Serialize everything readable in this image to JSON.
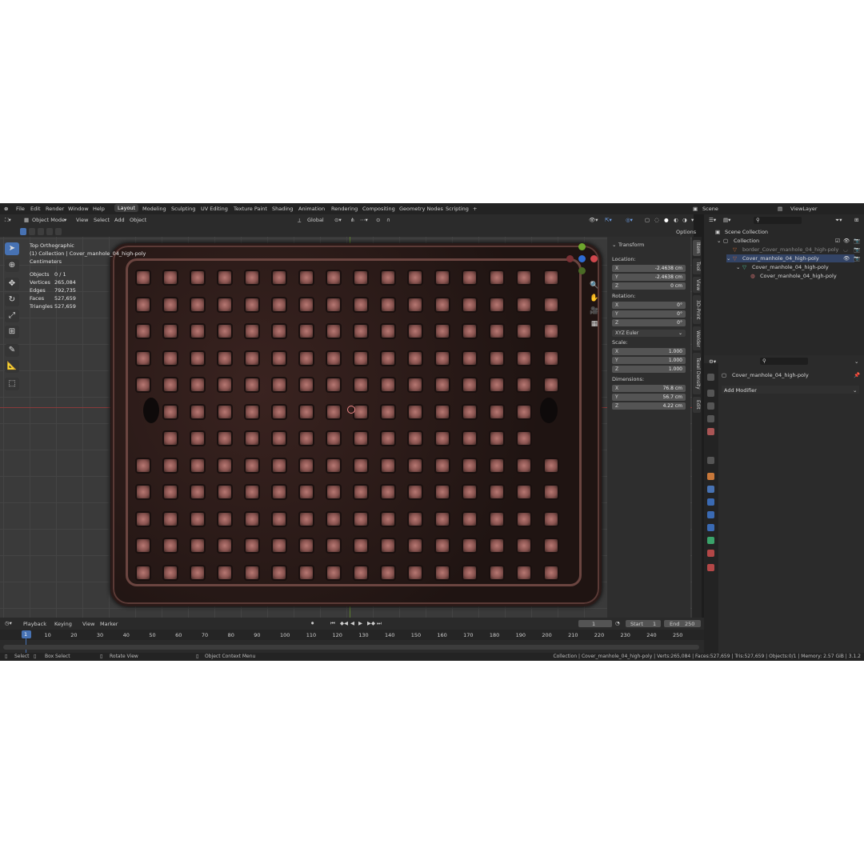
{
  "menu": {
    "items": [
      "File",
      "Edit",
      "Render",
      "Window",
      "Help"
    ],
    "workspaces": [
      "Layout",
      "Modeling",
      "Sculpting",
      "UV Editing",
      "Texture Paint",
      "Shading",
      "Animation",
      "Rendering",
      "Compositing",
      "Geometry Nodes",
      "Scripting",
      "+"
    ],
    "active_workspace": "Layout",
    "scene_label": "Scene",
    "view_layer_label": "ViewLayer"
  },
  "viewport_header": {
    "mode": "Object Mode",
    "menus": [
      "View",
      "Select",
      "Add",
      "Object"
    ],
    "orientation": "Global",
    "options": "Options"
  },
  "overlay": {
    "view_name": "Top Orthographic",
    "collection_line": "(1) Collection | Cover_manhole_04_high-poly",
    "units": "Centimeters",
    "stats": [
      {
        "label": "Objects",
        "value": "0 / 1"
      },
      {
        "label": "Vertices",
        "value": "265,084"
      },
      {
        "label": "Edges",
        "value": "792,735"
      },
      {
        "label": "Faces",
        "value": "527,659"
      },
      {
        "label": "Triangles",
        "value": "527,659"
      }
    ]
  },
  "npanel": {
    "section": "Transform",
    "location_label": "Location:",
    "location": [
      {
        "axis": "X",
        "value": "-2.4638 cm"
      },
      {
        "axis": "Y",
        "value": "-2.4638 cm"
      },
      {
        "axis": "Z",
        "value": "0 cm"
      }
    ],
    "rotation_label": "Rotation:",
    "rotation": [
      {
        "axis": "X",
        "value": "0°"
      },
      {
        "axis": "Y",
        "value": "0°"
      },
      {
        "axis": "Z",
        "value": "0°"
      }
    ],
    "rotation_mode": "XYZ Euler",
    "scale_label": "Scale:",
    "scale": [
      {
        "axis": "X",
        "value": "1.000"
      },
      {
        "axis": "Y",
        "value": "1.000"
      },
      {
        "axis": "Z",
        "value": "1.000"
      }
    ],
    "dimensions_label": "Dimensions:",
    "dimensions": [
      {
        "axis": "X",
        "value": "76.8 cm"
      },
      {
        "axis": "Y",
        "value": "56.7 cm"
      },
      {
        "axis": "Z",
        "value": "4.22 cm"
      }
    ],
    "tabs": [
      "Item",
      "Tool",
      "View",
      "3D-Print",
      "Welder",
      "Texel Density",
      "Edit"
    ]
  },
  "outliner": {
    "scene_collection": "Scene Collection",
    "collection": "Collection",
    "items": [
      "border_Cover_manhole_04_high-poly",
      "Cover_manhole_04_high-poly",
      "Cover_manhole_04_high-poly",
      "Cover_manhole_04_high-poly"
    ]
  },
  "properties": {
    "object_name": "Cover_manhole_04_high-poly",
    "add_modifier": "Add Modifier"
  },
  "timeline": {
    "menus": [
      "Playback",
      "Keying",
      "View",
      "Marker"
    ],
    "current_frame": "1",
    "start_label": "Start",
    "start": "1",
    "end_label": "End",
    "end": "250",
    "ticks": [
      "1",
      "10",
      "20",
      "30",
      "40",
      "50",
      "60",
      "70",
      "80",
      "90",
      "100",
      "110",
      "120",
      "130",
      "140",
      "150",
      "160",
      "170",
      "180",
      "190",
      "200",
      "210",
      "220",
      "230",
      "240",
      "250"
    ]
  },
  "statusbar": {
    "select": "Select",
    "box_select": "Box Select",
    "rotate_view": "Rotate View",
    "context_menu": "Object Context Menu",
    "info": "Collection | Cover_manhole_04_high-poly | Verts:265,084 | Faces:527,659 | Tris:527,659 | Objects:0/1 | Memory: 2.57 GiB | 3.1.2"
  },
  "colors": {
    "accent": "#4772b3",
    "mesh": "#b77873",
    "background": "#3a3a3a"
  }
}
